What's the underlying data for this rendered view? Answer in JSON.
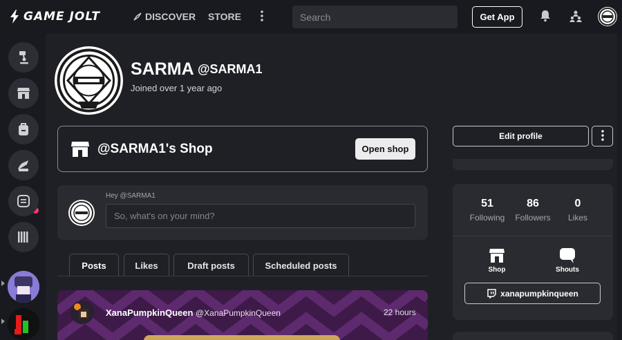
{
  "header": {
    "logo_text": "GAME JOLT",
    "nav_discover": "DISCOVER",
    "nav_store": "STORE",
    "search_placeholder": "Search",
    "get_app": "Get App"
  },
  "sidebar": {
    "items": [
      {
        "icon": "user-badge-icon"
      },
      {
        "icon": "store-icon"
      },
      {
        "icon": "backpack-icon"
      },
      {
        "icon": "quest-icon"
      },
      {
        "icon": "chat-icon"
      },
      {
        "icon": "library-icon"
      }
    ],
    "games": [
      {
        "name": "game-thumbnail-purple"
      },
      {
        "name": "game-thumbnail-blocks"
      }
    ]
  },
  "profile": {
    "name": "SARMA",
    "handle": "@SARMA1",
    "joined": "Joined over 1 year ago"
  },
  "shop": {
    "title": "@SARMA1's Shop",
    "open_button": "Open shop"
  },
  "compose": {
    "hey": "Hey @SARMA1",
    "placeholder": "So, what's on your mind?"
  },
  "tabs": [
    {
      "label": "Posts",
      "active": true
    },
    {
      "label": "Likes",
      "active": false
    },
    {
      "label": "Draft posts",
      "active": false
    },
    {
      "label": "Scheduled posts",
      "active": false
    }
  ],
  "post": {
    "author": "XanaPumpkinQueen",
    "handle": "@XanaPumpkinQueen",
    "time": "22 hours"
  },
  "right": {
    "edit_profile": "Edit profile",
    "stats": [
      {
        "value": "51",
        "label": "Following"
      },
      {
        "value": "86",
        "label": "Followers"
      },
      {
        "value": "0",
        "label": "Likes"
      }
    ],
    "links": [
      {
        "label": "Shop",
        "icon": "store-icon"
      },
      {
        "label": "Shouts",
        "icon": "speech-bubble-icon"
      }
    ],
    "twitch": "xanapumpkinqueen"
  },
  "colors": {
    "bg": "#1f2026",
    "panel": "#2a2b31",
    "topbar": "#191a1f",
    "notification_dot": "#ff3869"
  }
}
